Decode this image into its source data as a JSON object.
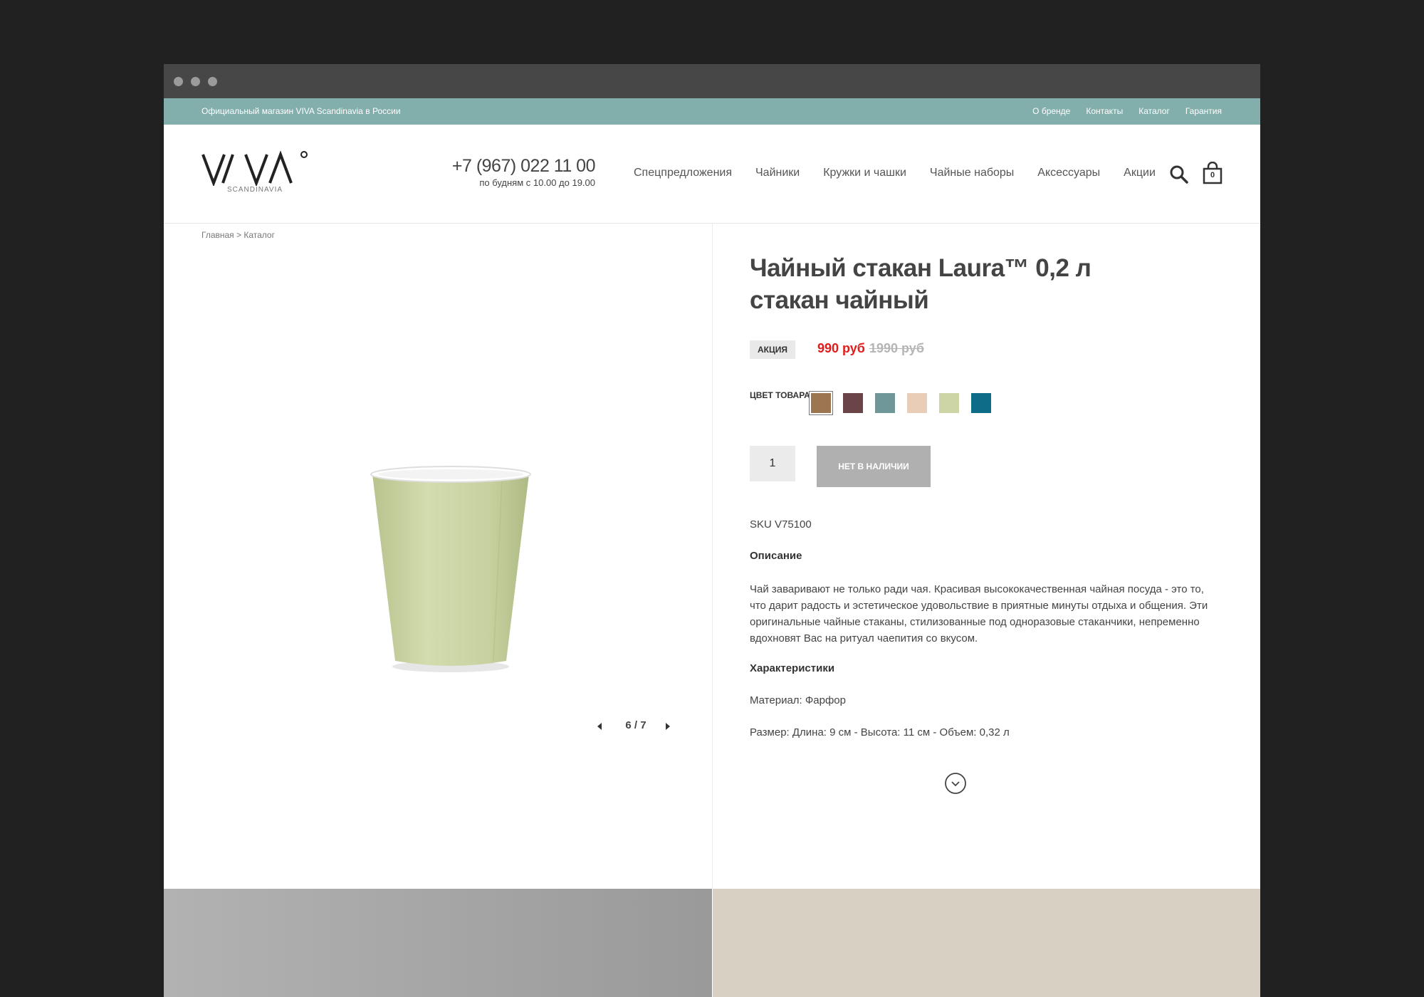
{
  "topbar": {
    "slogan": "Официальный магазин VIVA Scandinavia в России",
    "links": [
      "О бренде",
      "Контакты",
      "Каталог",
      "Гарантия"
    ]
  },
  "header": {
    "logo_text": "VIVA",
    "logo_sub": "SCANDINAVIA",
    "phone": "+7 (967) 022 11 00",
    "hours": "по будням с 10.00 до 19.00",
    "nav": [
      "Спецпредложения",
      "Чайники",
      "Кружки и чашки",
      "Чайные наборы",
      "Аксессуары",
      "Акции"
    ],
    "cart_count": "0",
    "icons": {
      "search": "search-icon",
      "cart": "shopping-bag-icon"
    }
  },
  "breadcrumb": "Главная > Каталог",
  "gallery": {
    "counter": "6 / 7",
    "icons": {
      "prev": "triangle-left-icon",
      "next": "triangle-right-icon"
    }
  },
  "product": {
    "title_line1": "Чайный стакан Laura™ 0,2 л",
    "title_line2": "стакан чайный",
    "badge": "АКЦИЯ",
    "price": "990 руб",
    "old_price": "1990 руб",
    "color_label": "ЦВЕТ ТОВАРА",
    "colors": [
      "#9b7650",
      "#6b4448",
      "#6f9799",
      "#e9cdb7",
      "#ccd5a3",
      "#0f6c89"
    ],
    "selected_color_index": 0,
    "quantity": "1",
    "button": "НЕТ В НАЛИЧИИ",
    "sku": "SKU V75100",
    "description_heading": "Описание",
    "description": "Чай заваривают не только ради чая. Красивая высококачественная чайная посуда - это то, что дарит радость и эстетическое удовольствие в приятные минуты отдыха и общения. Эти оригинальные чайные стаканы, стилизованные под одноразовые стаканчики, непременно вдохновят Вас на ритуал чаепития со вкусом.",
    "characteristics_heading": "Характеристики",
    "material": "Материал: Фарфор",
    "size": "Размер: Длина: 9 см - Высота: 11 см  - Объем: 0,32 л"
  },
  "colors": {
    "topbar": "#82aeab",
    "price": "#e21b1b",
    "button": "#b0b0b0",
    "cup": "#cbd6a6"
  }
}
